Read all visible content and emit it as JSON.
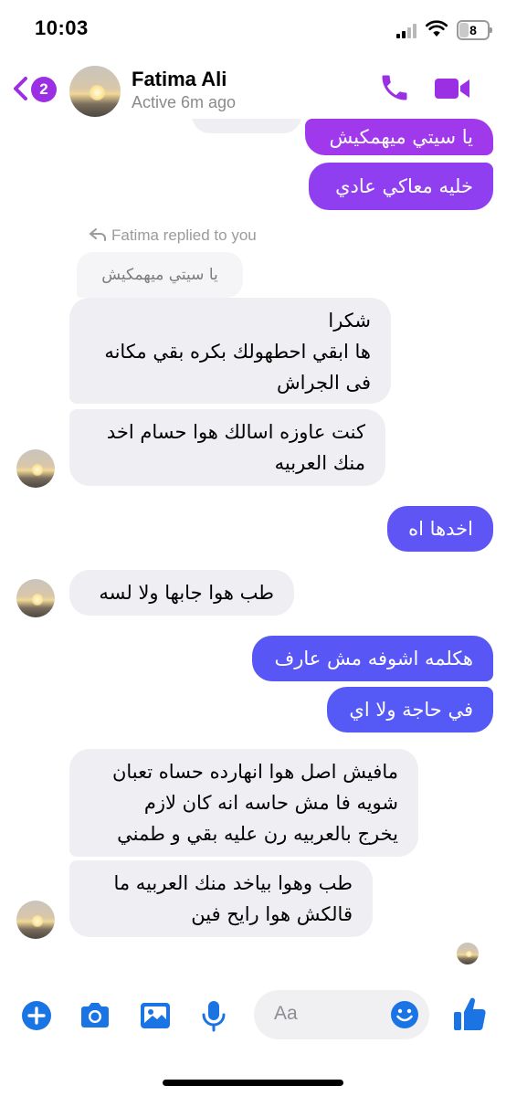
{
  "status_bar": {
    "time": "10:03",
    "battery": "8"
  },
  "header": {
    "back_badge": "2",
    "contact_name": "Fatima Ali",
    "contact_status": "Active 6m ago"
  },
  "thread": {
    "out_1": "يا سيتي ميهمكيش",
    "out_2": "خليه معاكي عادي",
    "reply_label": "Fatima replied to you",
    "reply_quote": "يا سيتي ميهمكيش",
    "in_1": "شكرا\nها ابقي احطهولك بكره بقي مكانه\nفى الجراش",
    "in_2": "كنت عاوزه اسالك هوا حسام اخد\nمنك العربيه",
    "out_3": "اخدها اه",
    "in_3": "طب هوا جابها ولا لسه",
    "out_4": "هكلمه اشوفه مش عارف",
    "out_5": "في حاجة ولا اي",
    "in_4": "مافيش اصل هوا انهارده حساه تعبان\nشويه فا مش حاسه انه كان لازم\nيخرج بالعربيه رن عليه بقي و طمني",
    "in_5": "طب وهوا بياخد منك العربيه ما\nقالكش هوا رايح فين"
  },
  "composer": {
    "placeholder": "Aa"
  },
  "colors": {
    "accent_purple": "#9b2fe3",
    "bubble_purple": "#8f3ff0",
    "bubble_blue": "#5b57f5",
    "incoming_gray": "#efeff3",
    "messenger_blue": "#1b74e4"
  }
}
